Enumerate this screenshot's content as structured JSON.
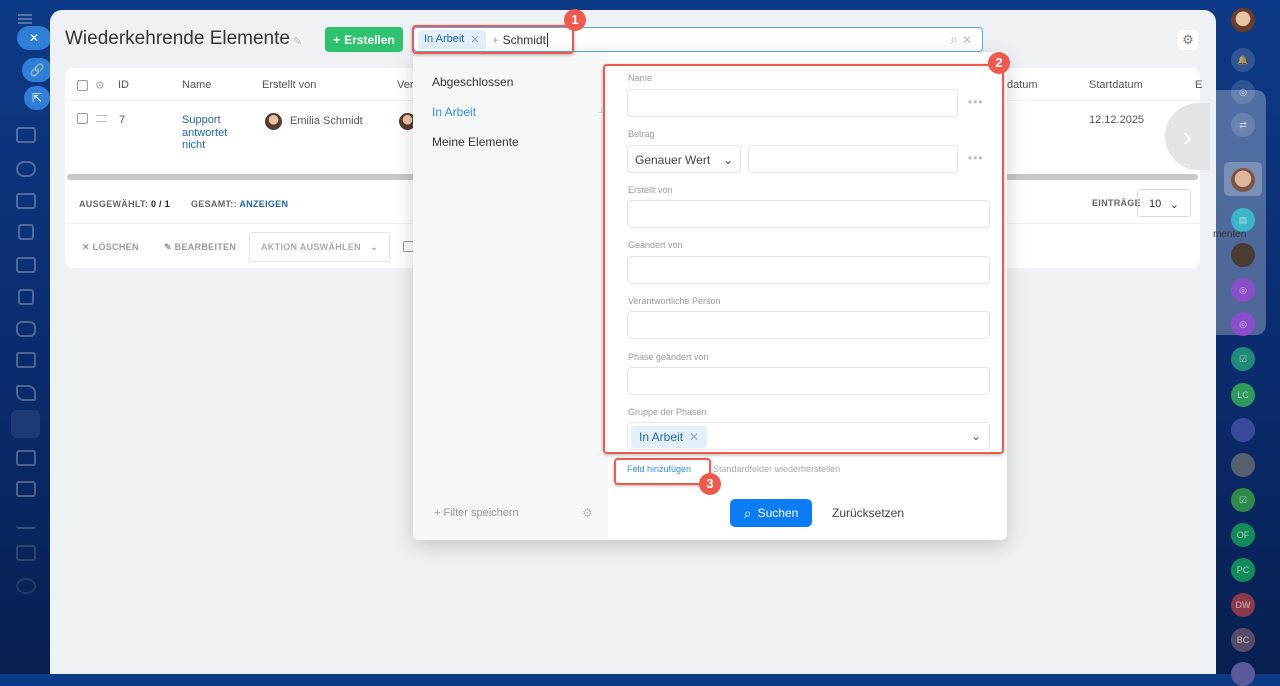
{
  "header": {
    "title": "Wiederkehrende Elemente",
    "create_label": "Erstellen",
    "settings_icon": "gear-icon"
  },
  "search": {
    "chip": "In Arbeit",
    "value": "Schmidt"
  },
  "table": {
    "columns": [
      "ID",
      "Name",
      "Erstellt von",
      "Ver",
      "datum",
      "Startdatum",
      "E"
    ],
    "rows": [
      {
        "id": "7",
        "name": "Support antwortet nicht",
        "created_by": "Emilia Schmidt",
        "start": "12.12.2025"
      }
    ],
    "selected_label": "AUSGEWÄHLT:",
    "selected_value": "0 / 1",
    "total_label": "GESAMT::",
    "total_link": "ANZEIGEN",
    "per_page_label": "EINTRÄGE",
    "per_page": "10",
    "actions": {
      "delete": "LÖSCHEN",
      "edit": "BEARBEITEN",
      "choose": "AKTION AUSWÄHLEN"
    }
  },
  "filter": {
    "presets": [
      "Abgeschlossen",
      "In Arbeit",
      "Meine Elemente"
    ],
    "save_filter": "Filter speichern",
    "fields": {
      "name": "Name",
      "amount": "Betrag",
      "amount_mode": "Genauer Wert",
      "created_by": "Erstellt von",
      "changed_by": "Geändert von",
      "responsible": "Verantwortliche Person",
      "phase_changed_by": "Phase geändert von",
      "phase_group": "Gruppe der Phasen",
      "phase_group_value": "In Arbeit"
    },
    "add_field": "Feld hinzufügen",
    "restore": "Standardfelder wiederherstellen",
    "search": "Suchen",
    "reset": "Zurücksetzen"
  },
  "annotations": [
    "1",
    "2",
    "3"
  ],
  "right_sidebar": {
    "partial_label": "menten",
    "avatars": [
      "LC",
      "OF",
      "PC",
      "DW",
      "BC"
    ]
  }
}
